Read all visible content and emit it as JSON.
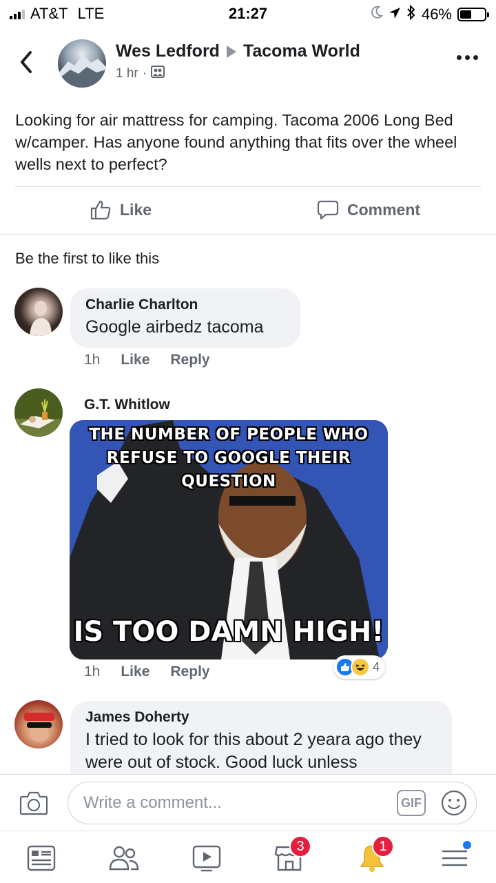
{
  "status_bar": {
    "carrier": "AT&T",
    "network": "LTE",
    "time": "21:27",
    "battery_percent": "46%",
    "battery_level": 0.46
  },
  "post": {
    "author": "Wes Ledford",
    "group": "Tacoma World",
    "time": "1 hr",
    "separator": "·",
    "text": "Looking for air mattress for camping. Tacoma 2006 Long Bed w/camper. Has anyone found anything that fits over the wheel wells next to perfect?",
    "like_label": "Like",
    "comment_label": "Comment",
    "likes_summary": "Be the first to like this"
  },
  "comments": [
    {
      "name": "Charlie Charlton",
      "text": "Google airbedz tacoma",
      "time": "1h",
      "like_label": "Like",
      "reply_label": "Reply"
    },
    {
      "name": "G.T. Whitlow",
      "meme_top": "THE NUMBER OF PEOPLE WHO REFUSE TO GOOGLE THEIR QUESTION",
      "meme_bottom": "IS TOO DAMN HIGH!",
      "time": "1h",
      "like_label": "Like",
      "reply_label": "Reply",
      "reaction_count": "4",
      "reactions": [
        "like-icon",
        "haha-icon"
      ]
    },
    {
      "name": "James Doherty",
      "text": "I tried to look for this about 2 yeara ago they were out of stock. Good luck unless"
    }
  ],
  "composer": {
    "placeholder": "Write a comment...",
    "gif_label": "GIF"
  },
  "bottom_nav": {
    "items": [
      "news-feed-icon",
      "friends-icon",
      "watch-icon",
      "marketplace-icon",
      "notifications-icon",
      "menu-icon"
    ],
    "marketplace_badge": "3",
    "notifications_badge": "1"
  },
  "colors": {
    "accent": "#1877f2",
    "badge": "#e41e3f",
    "bubble": "#f0f2f5",
    "meme_bg": "#3356b6"
  }
}
